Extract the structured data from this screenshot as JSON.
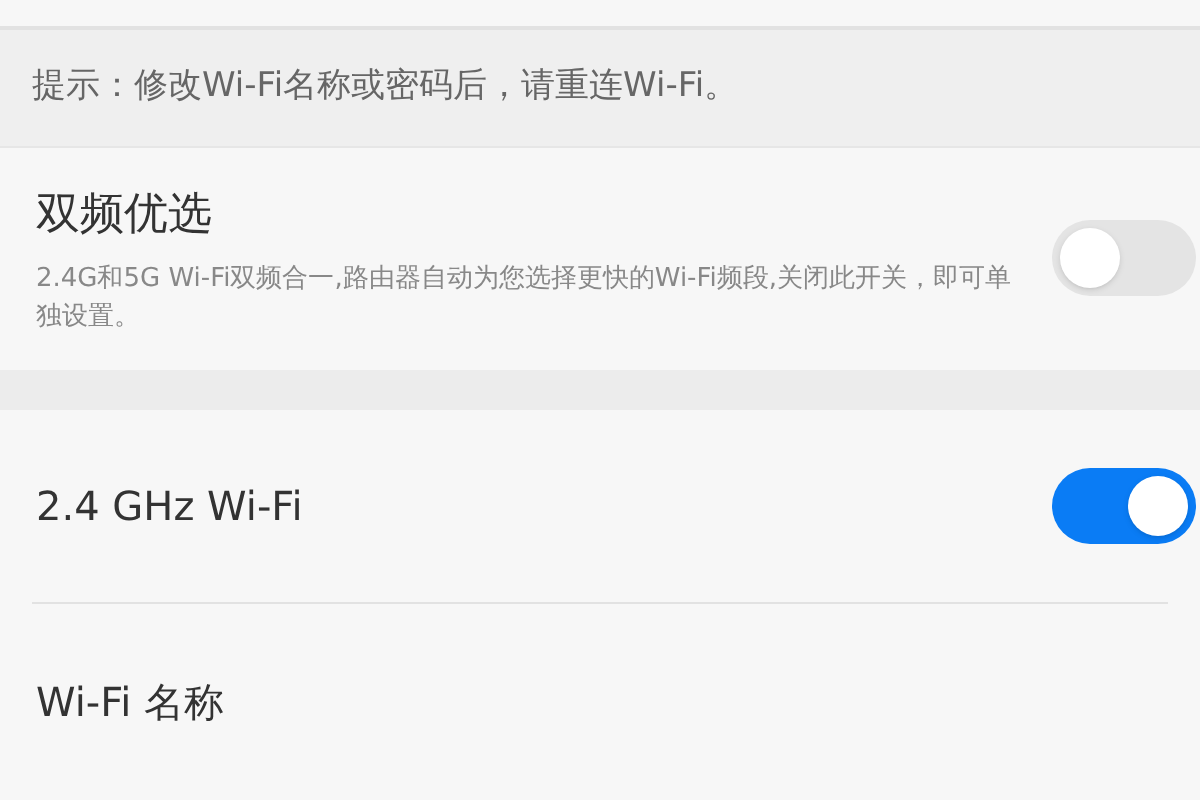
{
  "hint": "提示：修改Wi-Fi名称或密码后，请重连Wi-Fi。",
  "dual_band": {
    "title": "双频优选",
    "description": "2.4G和5G Wi-Fi双频合一,路由器自动为您选择更快的Wi-Fi频段,关闭此开关，即可单独设置。",
    "on": false
  },
  "wifi_24": {
    "label": "2.4 GHz Wi-Fi",
    "on": true
  },
  "wifi_name": {
    "label": "Wi-Fi 名称"
  }
}
